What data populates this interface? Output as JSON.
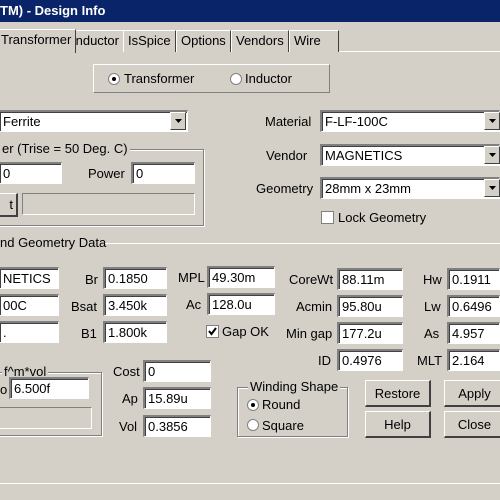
{
  "window": {
    "title": "TM) - Design Info"
  },
  "tabs": [
    "Transformer",
    "Inductor",
    "IsSpice",
    "Options",
    "Vendors",
    "Wire"
  ],
  "mode": {
    "options": [
      "Transformer",
      "Inductor"
    ],
    "selected": "Transformer"
  },
  "core": {
    "type_value": "Ferrite",
    "material_label": "Material",
    "material_value": "F-LF-100C",
    "vendor_label": "Vendor",
    "vendor_value": "MAGNETICS",
    "geometry_label": "Geometry",
    "geometry_value": "28mm x 23mm",
    "lock_geometry_label": "Lock Geometry",
    "lock_geometry_checked": false
  },
  "temp_group": {
    "title": "er  (Trise = 50 Deg. C)",
    "left_value": "0",
    "power_label": "Power",
    "power_value": "0",
    "button_label": "t"
  },
  "geometry_data": {
    "title": "nd Geometry Data",
    "left_col": [
      "NETICS",
      "00C",
      "."
    ],
    "br_label": "Br",
    "br_value": "0.1850",
    "bsat_label": "Bsat",
    "bsat_value": "3.450k",
    "b1_label": "B1",
    "b1_value": "1.800k",
    "mpl_label": "MPL",
    "mpl_value": "49.30m",
    "ac_label": "Ac",
    "ac_value": "128.0u",
    "gap_ok_label": "Gap OK",
    "gap_ok_checked": true,
    "corewt_label": "CoreWt",
    "corewt_value": "88.11m",
    "acmin_label": "Acmin",
    "acmin_value": "95.80u",
    "mingap_label": "Min gap",
    "mingap_value": "177.2u",
    "id_label": "ID",
    "id_value": "0.4976",
    "hw_label": "Hw",
    "hw_value": "0.1911",
    "lw_label": "Lw",
    "lw_value": "0.6496",
    "as_label": "As",
    "as_value": "4.957",
    "mlt_label": "MLT",
    "mlt_value": "2.164"
  },
  "loss_group": {
    "title": "f^m*vol",
    "field_label": "o",
    "field_value": "6.500f"
  },
  "cost": {
    "cost_label": "Cost",
    "cost_value": "0",
    "ap_label": "Ap",
    "ap_value": "15.89u",
    "vol_label": "Vol",
    "vol_value": "0.3856"
  },
  "winding_shape": {
    "title": "Winding Shape",
    "options": [
      "Round",
      "Square"
    ],
    "selected": "Round"
  },
  "buttons": {
    "restore": "Restore",
    "apply": "Apply",
    "help": "Help",
    "close": "Close"
  }
}
